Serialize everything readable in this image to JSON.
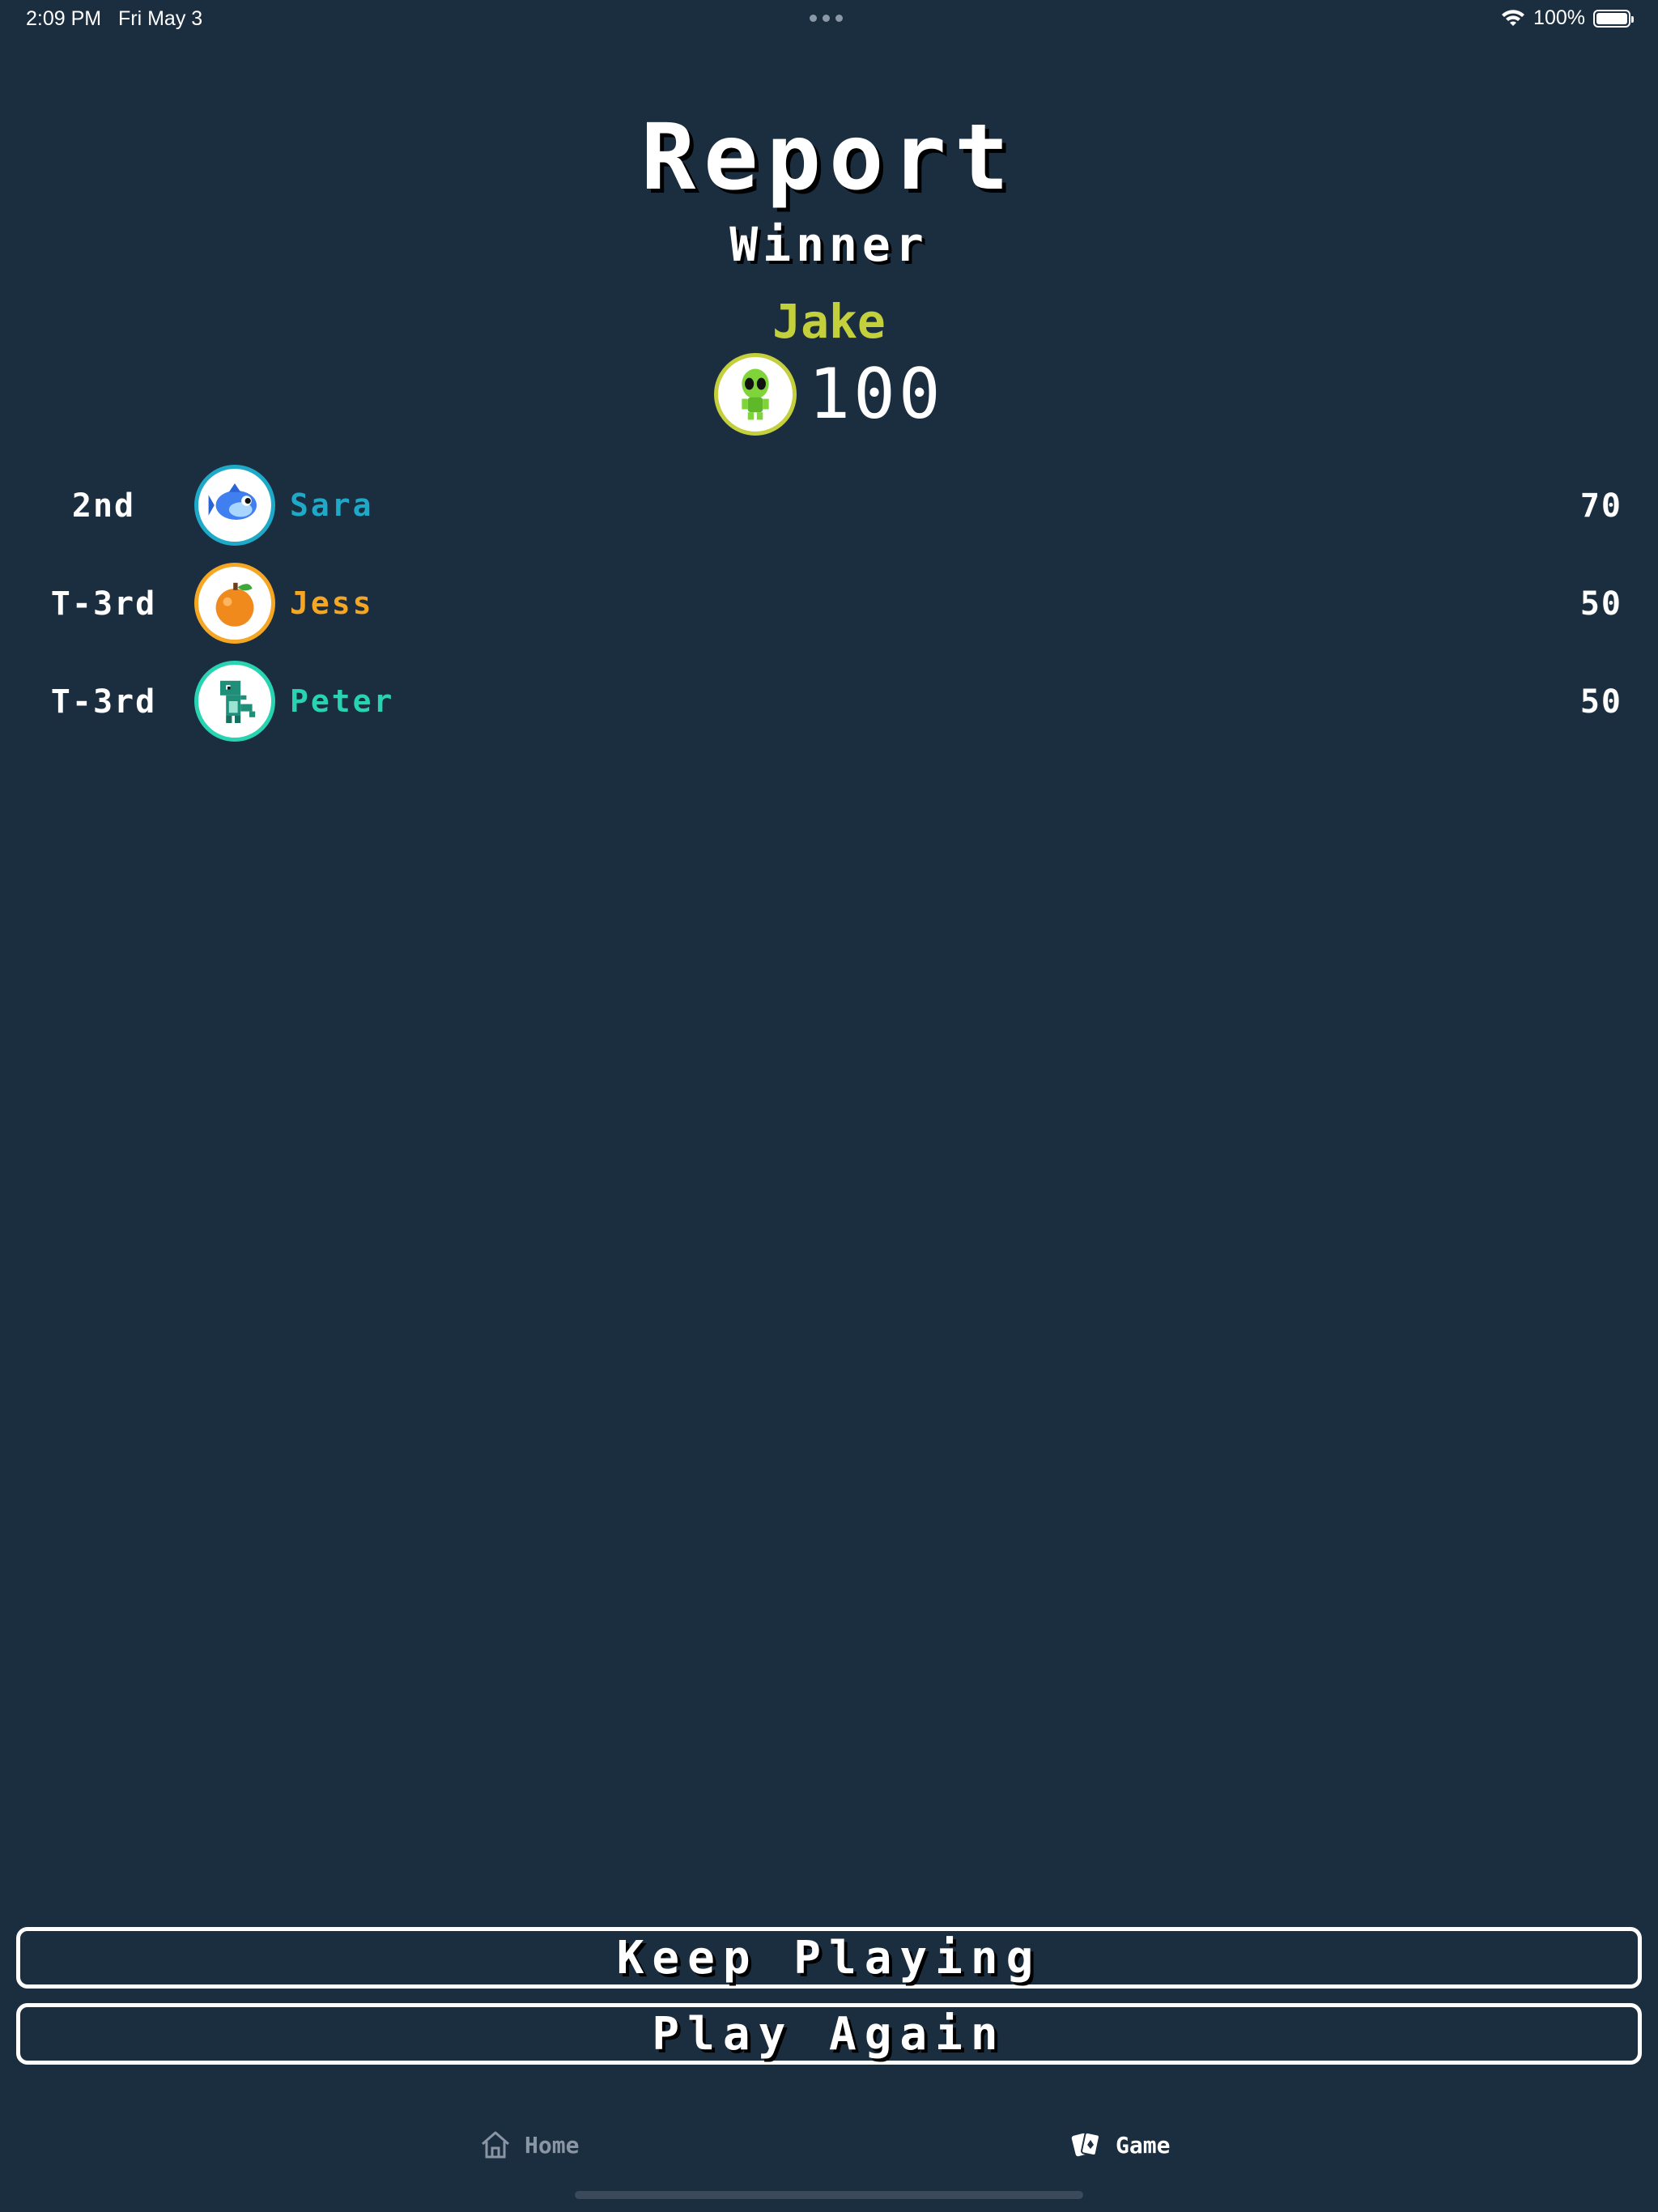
{
  "status_bar": {
    "time": "2:09 PM",
    "date": "Fri May 3",
    "battery": "100%",
    "battery_level": 1.0
  },
  "report": {
    "title": "Report",
    "subtitle": "Winner",
    "winner": {
      "name": "Jake",
      "score": "100",
      "avatar": "alien-icon",
      "color": "#c4cf3c"
    }
  },
  "rankings": [
    {
      "rank": "2nd",
      "name": "Sara",
      "score": "70",
      "avatar": "fish-icon",
      "color": "#1ea9c9"
    },
    {
      "rank": "T-3rd",
      "name": "Jess",
      "score": "50",
      "avatar": "orange-icon",
      "color": "#f5a623"
    },
    {
      "rank": "T-3rd",
      "name": "Peter",
      "score": "50",
      "avatar": "dinosaur-icon",
      "color": "#27d3b0"
    }
  ],
  "actions": {
    "keep_playing": "Keep Playing",
    "play_again": "Play Again"
  },
  "tabs": [
    {
      "label": "Home",
      "icon": "house-icon",
      "active": false
    },
    {
      "label": "Game",
      "icon": "cards-icon",
      "active": true
    }
  ],
  "colors": {
    "background": "#1b2e40",
    "text": "#ffffff",
    "inactive_tab": "#8b96a4"
  }
}
